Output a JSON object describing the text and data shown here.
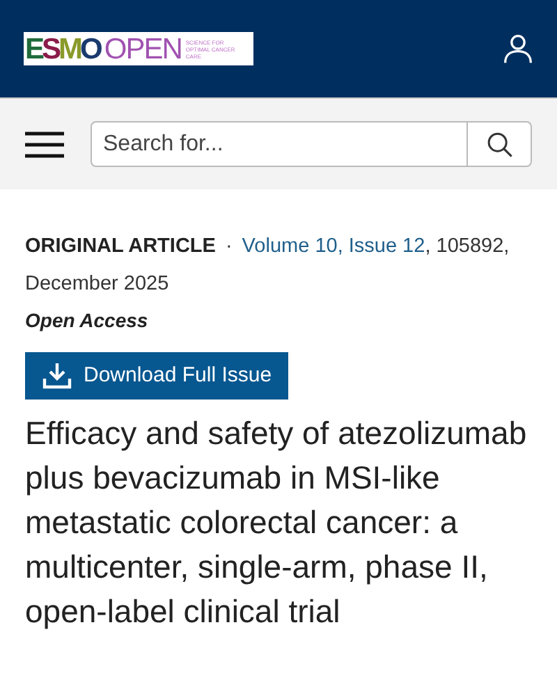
{
  "header": {
    "logo": {
      "brand": "ESMO",
      "product": "OPEN",
      "tagline": "SCIENCE FOR OPTIMAL CANCER CARE"
    }
  },
  "search": {
    "placeholder": "Search for..."
  },
  "article": {
    "type": "ORIGINAL ARTICLE",
    "separator": "·",
    "issue_link": "Volume 10, Issue 12",
    "citation": ", 105892, December 2025",
    "access": "Open Access",
    "download_button": "Download Full Issue",
    "title": "Efficacy and safety of atezolizumab plus bevacizumab in MSI-like metastatic colorectal cancer: a multicenter, single-arm, phase II, open-label clinical trial"
  }
}
